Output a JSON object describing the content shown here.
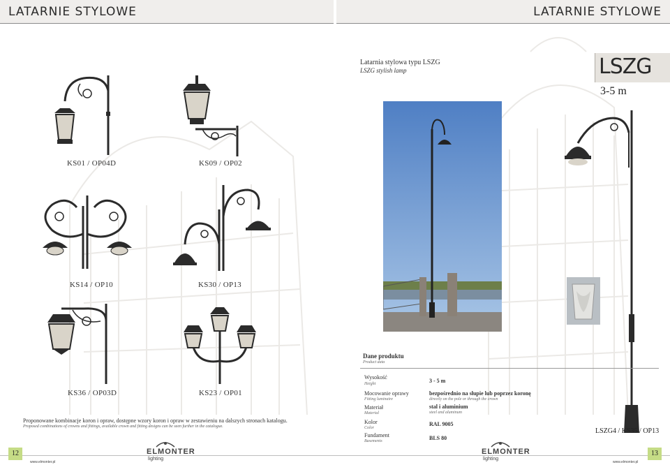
{
  "header": {
    "left_title": "LATARNIE STYLOWE",
    "right_title": "LATARNIE STYLOWE"
  },
  "product": {
    "name_pl": "Latarnia stylowa typu LSZG",
    "name_en": "LSZG stylish lamp",
    "code": "LSZG",
    "height": "3-5 m"
  },
  "combinations": {
    "items": [
      "KS01 / OP04D",
      "KS09 / OP02",
      "KS14 / OP10",
      "KS30 / OP13",
      "KS36 / OP03D",
      "KS23 / OP01"
    ],
    "note_pl": "Proponowane kombinacje koron i opraw, dostępne wzory koron i opraw w zestawieniu na dalszych stronach katalogu.",
    "note_en": "Proposed combinations of crowns and fittings, available crown and fitting designs can be seen further in the catalogue."
  },
  "product_data": {
    "title_pl": "Dane produktu",
    "title_en": "Product data",
    "rows": [
      {
        "label_pl": "Wysokość",
        "label_en": "Height",
        "value_pl": "3 - 5 m",
        "value_en": ""
      },
      {
        "label_pl": "Mocowanie oprawy",
        "label_en": "Fitting luminaire",
        "value_pl": "bezpośrednio na słupie lub poprzez koronę",
        "value_en": "directly on the pole or through the crown"
      },
      {
        "label_pl": "Materiał",
        "label_en": "Material",
        "value_pl": "stal i aluminium",
        "value_en": "steel and aluminum"
      },
      {
        "label_pl": "Kolor",
        "label_en": "Color",
        "value_pl": "RAL 9005",
        "value_en": ""
      },
      {
        "label_pl": "Fundament",
        "label_en": "Basements",
        "value_pl": "BLS 80",
        "value_en": ""
      }
    ]
  },
  "main_lamp_caption": "LSZG4 / KS35 / OP13",
  "footer": {
    "page_left": "12",
    "page_right": "13",
    "url_left": "www.elmonter.pl",
    "url_right": "www.elmonter.pl",
    "brand": "ELMONTER",
    "brand_sub": "lighting"
  },
  "colors": {
    "header_bg": "#f0eeec",
    "page_badge": "#c5dc86",
    "lamp": "#2b2b2b"
  }
}
